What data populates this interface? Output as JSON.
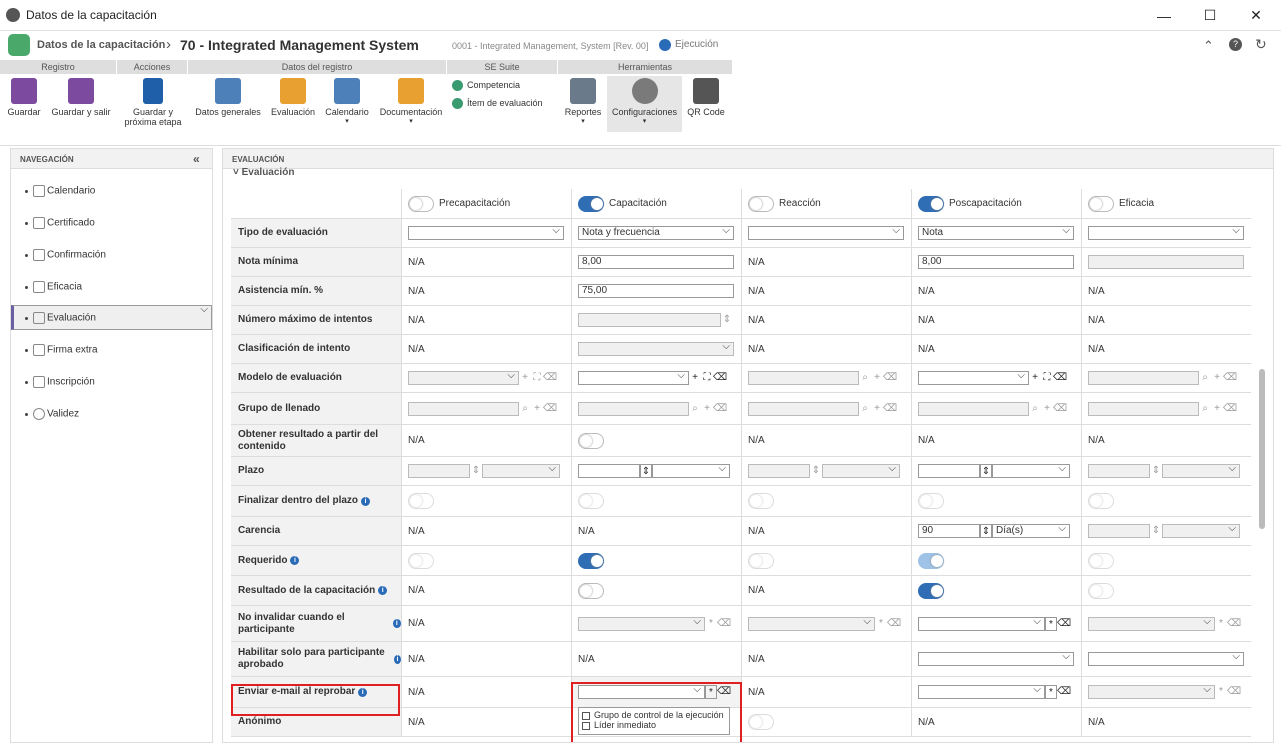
{
  "window": {
    "title": "Datos de la capacitación"
  },
  "header": {
    "module": "Datos de la capacitación",
    "record": "70 - Integrated Management System",
    "ref": "0001 - Integrated Management, System [Rev. 00]",
    "status": "Ejecución"
  },
  "ribbon": {
    "groups": [
      "Registro",
      "Acciones",
      "Datos del registro",
      "SE Suite",
      "Herramientas"
    ],
    "buttons": {
      "save": "Guardar",
      "save_exit": "Guardar y salir",
      "save_next": "Guardar y\npróxima etapa",
      "general": "Datos generales",
      "eval": "Evaluación",
      "calendar": "Calendario",
      "docs": "Documentación",
      "competence": "Competencia",
      "eval_item": "Ítem de evaluación",
      "reports": "Reportes",
      "config": "Configuraciones",
      "qr": "QR Code"
    }
  },
  "nav": {
    "title": "NAVEGACIÓN",
    "items": [
      "Calendario",
      "Certificado",
      "Confirmación",
      "Eficacia",
      "Evaluación",
      "Firma extra",
      "Inscripción",
      "Validez"
    ]
  },
  "main": {
    "title": "EVALUACIÓN",
    "section": "Evaluación",
    "columns": [
      "Precapacitación",
      "Capacitación",
      "Reacción",
      "Poscapacitación",
      "Eficacia"
    ],
    "rows": {
      "tipo": "Tipo de evaluación",
      "nota_min": "Nota mínima",
      "asistencia": "Asistencia mín. %",
      "intentos": "Número máximo de intentos",
      "clasif": "Clasificación de intento",
      "modelo": "Modelo de evaluación",
      "grupo": "Grupo de llenado",
      "obtener": "Obtener resultado a partir del contenido",
      "plazo": "Plazo",
      "finalizar": "Finalizar dentro del plazo",
      "carencia": "Carencia",
      "requerido": "Requerido",
      "resultado": "Resultado de la capacitación",
      "no_invalidar": "No invalidar cuando el participante",
      "habilitar": "Habilitar solo para participante aprobado",
      "email": "Enviar e-mail al reprobar",
      "anonimo": "Anónimo"
    },
    "values": {
      "na": "N/A",
      "nota_frecuencia": "Nota y frecuencia",
      "nota": "Nota",
      "ocho": "8,00",
      "setentacinco": "75,00",
      "noventa": "90",
      "dias": "Día(s)"
    },
    "dropdown": {
      "opt1": "Grupo de control de la ejecución",
      "opt2": "Líder inmediato"
    }
  }
}
